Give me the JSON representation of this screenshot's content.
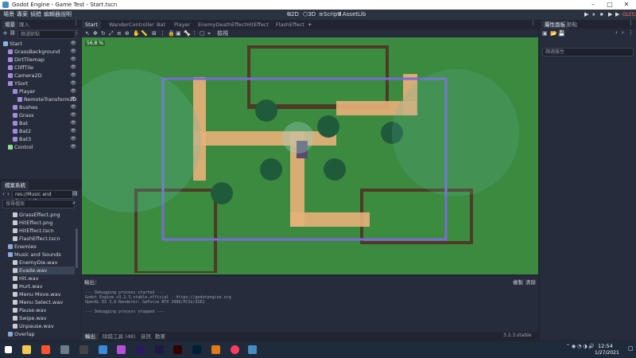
{
  "window": {
    "title": "Godot Engine - Game Test - Start.tscn",
    "minimize": "–",
    "maximize": "□",
    "close": "✕"
  },
  "menubar": {
    "menus": [
      "場景",
      "專案",
      "偵錯",
      "編輯器",
      "說明"
    ],
    "workspaces": [
      "2D",
      "3D",
      "Script",
      "AssetLib"
    ],
    "play_buttons": [
      "▶",
      "⏸",
      "⏹",
      "▶",
      "▶"
    ],
    "renderer": "GLES3"
  },
  "scene_dock": {
    "tabs": [
      "場景",
      "匯入"
    ],
    "filter_placeholder": "篩選節點",
    "nodes": [
      {
        "label": "Start",
        "depth": 0,
        "color": "#8fb2e8"
      },
      {
        "label": "GrassBackground",
        "depth": 1,
        "color": "#a48adf"
      },
      {
        "label": "DirtTilemap",
        "depth": 1,
        "color": "#a48adf"
      },
      {
        "label": "CliffTile",
        "depth": 1,
        "color": "#a48adf"
      },
      {
        "label": "Camera2D",
        "depth": 1,
        "color": "#a48adf"
      },
      {
        "label": "YSort",
        "depth": 1,
        "color": "#a48adf"
      },
      {
        "label": "Player",
        "depth": 2,
        "color": "#a48adf"
      },
      {
        "label": "RemoteTransform2D",
        "depth": 3,
        "color": "#a48adf"
      },
      {
        "label": "Bushes",
        "depth": 2,
        "color": "#a48adf"
      },
      {
        "label": "Grass",
        "depth": 2,
        "color": "#a48adf"
      },
      {
        "label": "Bat",
        "depth": 2,
        "color": "#a48adf"
      },
      {
        "label": "Bat2",
        "depth": 2,
        "color": "#a48adf"
      },
      {
        "label": "Bat3",
        "depth": 2,
        "color": "#a48adf"
      },
      {
        "label": "Control",
        "depth": 1,
        "color": "#8fe08f"
      }
    ]
  },
  "filesystem_dock": {
    "title": "檔案系統",
    "path": "res://Music and Sounds/E",
    "search_placeholder": "搜尋檔案",
    "files": [
      {
        "label": "GrassEffect.png",
        "depth": 2
      },
      {
        "label": "HitEffect.png",
        "depth": 2
      },
      {
        "label": "HitEffect.tscn",
        "depth": 2
      },
      {
        "label": "FlashEffect.tscn",
        "depth": 2
      },
      {
        "label": "Enemies",
        "depth": 1
      },
      {
        "label": "Music and Sounds",
        "depth": 1
      },
      {
        "label": "EnemyDie.wav",
        "depth": 2
      },
      {
        "label": "Evade.wav",
        "depth": 2,
        "selected": true
      },
      {
        "label": "Hit.wav",
        "depth": 2
      },
      {
        "label": "Hurt.wav",
        "depth": 2
      },
      {
        "label": "Menu Move.wav",
        "depth": 2
      },
      {
        "label": "Menu Select.wav",
        "depth": 2
      },
      {
        "label": "Pause.wav",
        "depth": 2
      },
      {
        "label": "Swipe.wav",
        "depth": 2
      },
      {
        "label": "Unpause.wav",
        "depth": 2
      },
      {
        "label": "Overlap",
        "depth": 1
      }
    ]
  },
  "editor_tabs": [
    "Start",
    "WanderController",
    "Bat",
    "Player",
    "EnemyDeathEffect",
    "HitEffect",
    "FlashEffect"
  ],
  "editor_tab_add": "+",
  "toolbar": {
    "view_label": "檢視"
  },
  "viewport": {
    "zoom": "56.8 %"
  },
  "output": {
    "title": "輸出：",
    "copy": "複製",
    "clear": "清除",
    "lines": [
      "--- Debugging process started ---",
      "Godot Engine v3.2.3.stable.official - https://godotengine.org",
      "OpenGL ES 3.0 Renderer: GeForce RTX 2080/PCIe/SSE2",
      "",
      "--- Debugging process stopped ---"
    ]
  },
  "bottom_tabs": [
    "輸出",
    "除錯工具 (48)",
    "音訊",
    "動畫"
  ],
  "version": "3.2.3.stable",
  "inspector": {
    "tabs": [
      "屬性面板",
      "節點"
    ],
    "filter_placeholder": "篩選屬性"
  },
  "taskbar": {
    "time": "12:54",
    "date": "1/27/2021"
  },
  "colors": {
    "accent": "#478cbf",
    "grass": "#3c8a3f",
    "dirt": "#e8b07a",
    "camera_rect": "#7a6ad8"
  }
}
